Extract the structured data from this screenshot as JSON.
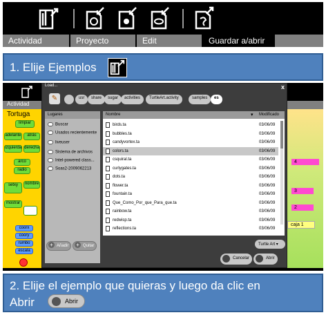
{
  "toolbar": {
    "icons": [
      "journal-icon",
      "import-icon",
      "import-project-icon",
      "view-source-icon",
      "save-snippet-icon"
    ],
    "tabs": [
      {
        "label": "Actividad",
        "active": false
      },
      {
        "label": "Proyecto",
        "active": false
      },
      {
        "label": "Edit",
        "active": false
      },
      {
        "label": "Guardar a/abrir de",
        "active": true
      }
    ]
  },
  "steps": {
    "step1": "1. Elije Ejemplos",
    "step2_line1": "2. Elije el ejemplo que quieras y luego da clic en",
    "step2_line2": "Abrir",
    "step2_button": "Abrir"
  },
  "screenshot": {
    "tab": "Actividad",
    "palette_title": "Tortuga",
    "palette_blocks": [
      "limpiar",
      "adelante",
      "atrás",
      "izquierda",
      "derecha",
      "arco",
      "radio",
      "setxy",
      "nombre",
      "mostrar",
      "coorx",
      "coory",
      "rumbo",
      "escala"
    ],
    "canvas_labels": [
      "4",
      "3",
      "2",
      "caja 1"
    ]
  },
  "dialog": {
    "title": "Load...",
    "close": "x",
    "path": [
      "usr",
      "share",
      "sugar",
      "activities",
      "TurtleArt.activity",
      "samples",
      "es"
    ],
    "places_header": "Lugares",
    "places": [
      "Buscar",
      "Usados recientemente",
      "liveuser",
      "Sistema de archivos",
      "Intel-powered class...",
      "Soas2-2009062213"
    ],
    "add_label": "Añadir",
    "remove_label": "Quitar",
    "columns": {
      "name": "Nombre",
      "modified": "Modificado"
    },
    "files": [
      {
        "name": "birds.ta",
        "date": "03/06/09"
      },
      {
        "name": "bubbles.ta",
        "date": "03/06/09"
      },
      {
        "name": "candyvortex.ta",
        "date": "03/06/09"
      },
      {
        "name": "colors.ta",
        "date": "03/06/09",
        "selected": true
      },
      {
        "name": "csquiral.ta",
        "date": "03/06/09"
      },
      {
        "name": "curlygates.ta",
        "date": "03/06/09"
      },
      {
        "name": "dots.ta",
        "date": "03/06/09"
      },
      {
        "name": "flower.ta",
        "date": "03/06/09"
      },
      {
        "name": "fountain.ta",
        "date": "03/06/09"
      },
      {
        "name": "Que_Como_Por_que_Para_que.ta",
        "date": "03/06/09"
      },
      {
        "name": "rainbow.ta",
        "date": "03/06/09"
      },
      {
        "name": "redwisp.ta",
        "date": "03/06/09"
      },
      {
        "name": "reflections.ta",
        "date": "03/06/09"
      }
    ],
    "filter": "Turtle Art",
    "cancel_label": "Cancelar",
    "open_label": "Abrir"
  }
}
